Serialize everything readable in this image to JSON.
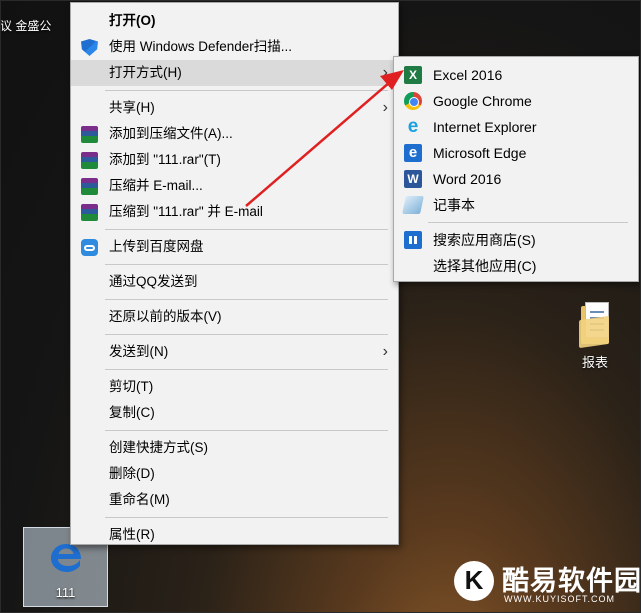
{
  "desktop": {
    "top_label": "议 金盛公",
    "folder_label": "报表",
    "selected_item_label": "111"
  },
  "context_menu": {
    "items": [
      {
        "label": "打开(O)",
        "icon": "none",
        "bold": true
      },
      {
        "label": "使用 Windows Defender扫描...",
        "icon": "windows-defender-shield-icon"
      },
      {
        "label": "打开方式(H)",
        "icon": "none",
        "submenu": true,
        "highlighted": true
      },
      {
        "label": "共享(H)",
        "icon": "none",
        "submenu": true
      },
      {
        "label": "添加到压缩文件(A)...",
        "icon": "winrar-icon"
      },
      {
        "label": "添加到 \"111.rar\"(T)",
        "icon": "winrar-icon"
      },
      {
        "label": "压缩并 E-mail...",
        "icon": "winrar-icon"
      },
      {
        "label": "压缩到 \"111.rar\" 并 E-mail",
        "icon": "winrar-icon"
      },
      {
        "label": "上传到百度网盘",
        "icon": "baidu-netdisk-icon"
      },
      {
        "label": "通过QQ发送到",
        "icon": "none"
      },
      {
        "label": "还原以前的版本(V)",
        "icon": "none"
      },
      {
        "label": "发送到(N)",
        "icon": "none",
        "submenu": true
      },
      {
        "label": "剪切(T)",
        "icon": "none"
      },
      {
        "label": "复制(C)",
        "icon": "none"
      },
      {
        "label": "创建快捷方式(S)",
        "icon": "none"
      },
      {
        "label": "删除(D)",
        "icon": "none"
      },
      {
        "label": "重命名(M)",
        "icon": "none"
      },
      {
        "label": "属性(R)",
        "icon": "none"
      }
    ],
    "submenu_arrow": "›"
  },
  "open_with_menu": {
    "items": [
      {
        "label": "Excel 2016",
        "icon": "excel-icon",
        "glyph": "X"
      },
      {
        "label": "Google Chrome",
        "icon": "chrome-icon"
      },
      {
        "label": "Internet Explorer",
        "icon": "internet-explorer-icon",
        "glyph": "e"
      },
      {
        "label": "Microsoft Edge",
        "icon": "edge-icon",
        "glyph": "e"
      },
      {
        "label": "Word 2016",
        "icon": "word-icon",
        "glyph": "W"
      },
      {
        "label": "记事本",
        "icon": "notepad-icon"
      },
      {
        "label": "搜索应用商店(S)",
        "icon": "store-icon"
      },
      {
        "label": "选择其他应用(C)",
        "icon": "none"
      }
    ]
  },
  "watermark": {
    "title": "酷易软件园",
    "url": "WWW.KUYISOFT.COM",
    "logo_letter": "K"
  },
  "colors": {
    "menu_bg": "#f2f2f2",
    "highlight": "#dadada",
    "arrow_annotation": "#e02020"
  }
}
